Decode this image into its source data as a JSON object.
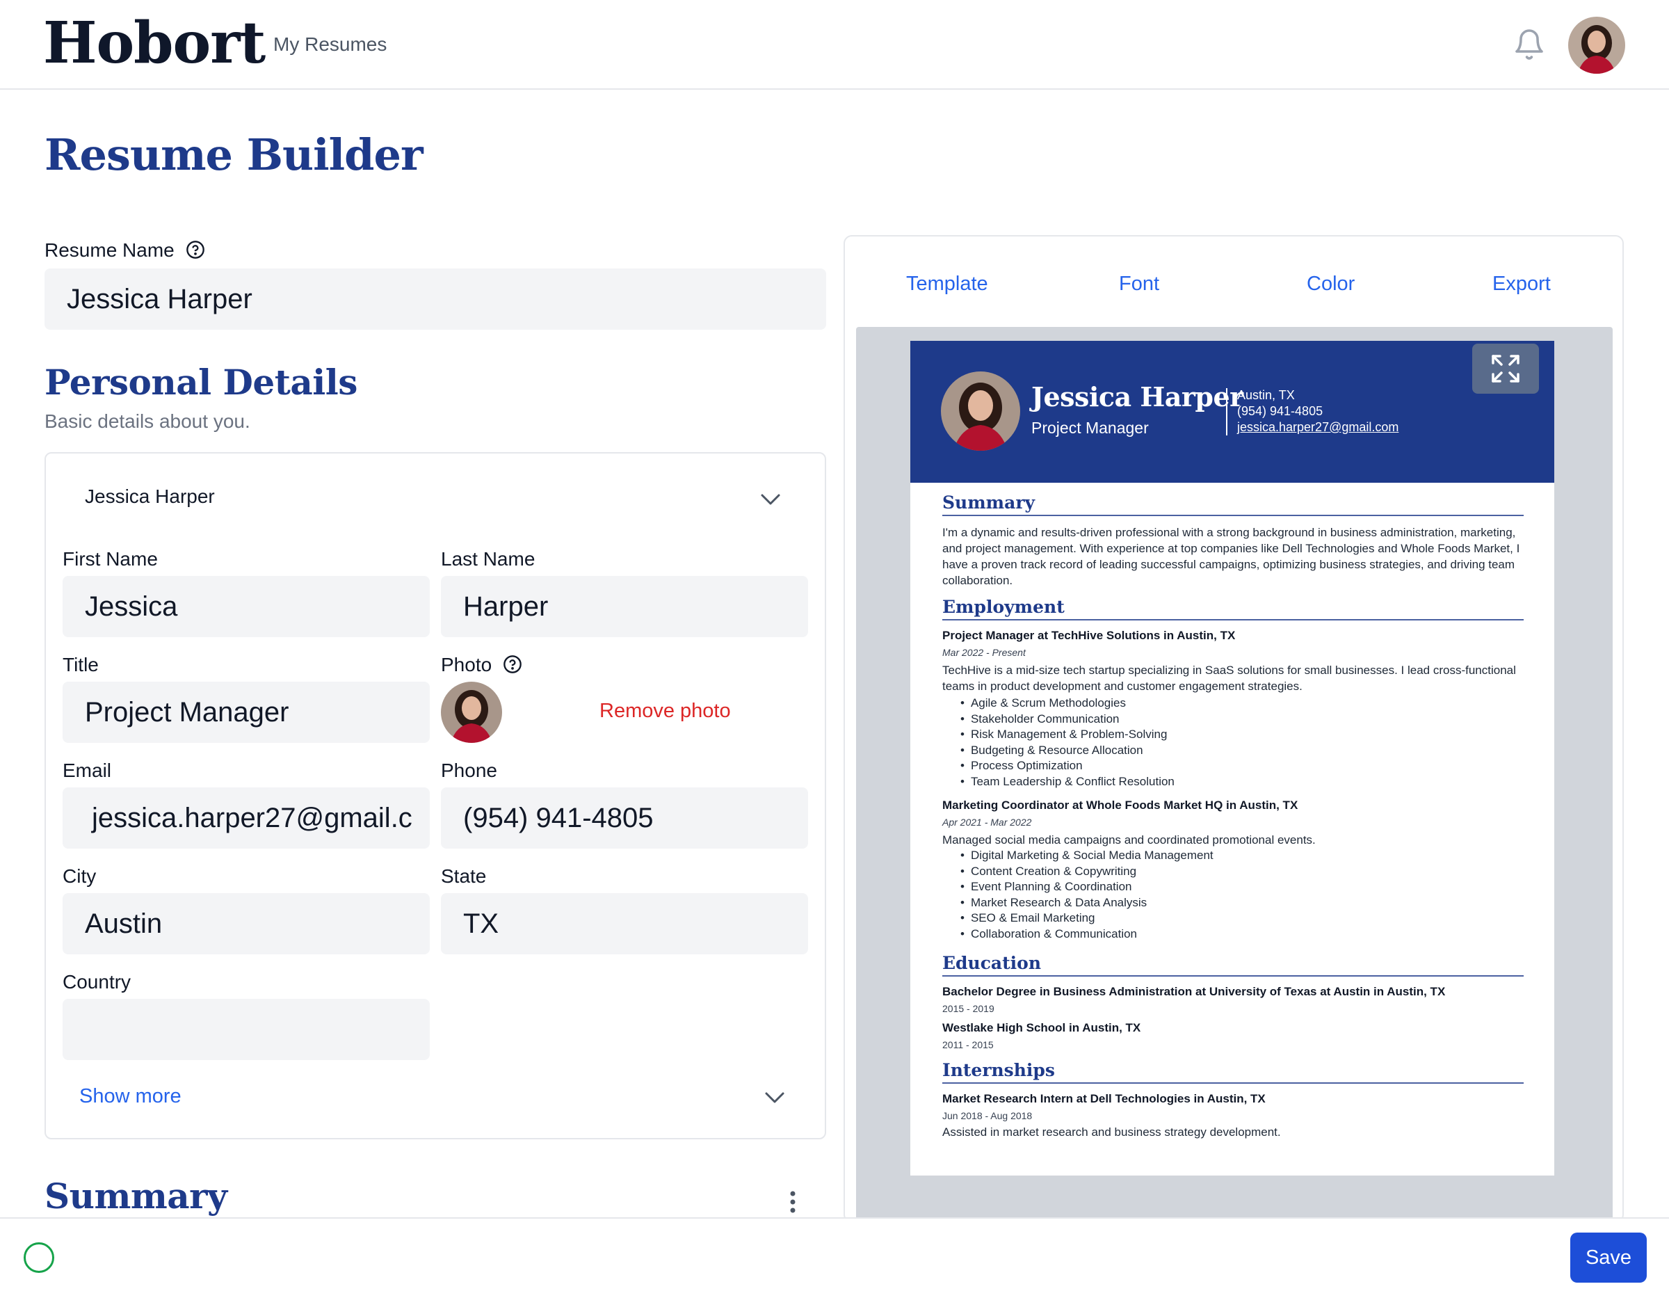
{
  "header": {
    "logo": "Hobort",
    "nav_my_resumes": "My Resumes"
  },
  "page_title": "Resume Builder",
  "resume_name": {
    "label": "Resume Name",
    "value": "Jessica Harper"
  },
  "personal_details": {
    "title": "Personal Details",
    "subtitle": "Basic details about you.",
    "card_header": "Jessica Harper",
    "first_name": {
      "label": "First Name",
      "value": "Jessica"
    },
    "last_name": {
      "label": "Last Name",
      "value": "Harper"
    },
    "title_field": {
      "label": "Title",
      "value": "Project Manager"
    },
    "photo": {
      "label": "Photo",
      "remove_label": "Remove photo"
    },
    "email": {
      "label": "Email",
      "value": "jessica.harper27@gmail.c"
    },
    "phone": {
      "label": "Phone",
      "value": "(954) 941-4805"
    },
    "city": {
      "label": "City",
      "value": "Austin"
    },
    "state": {
      "label": "State",
      "value": "TX"
    },
    "country": {
      "label": "Country",
      "value": ""
    },
    "show_more": "Show more"
  },
  "summary_section": {
    "title": "Summary"
  },
  "preview": {
    "tabs": [
      "Template",
      "Font",
      "Color",
      "Export"
    ],
    "name": "Jessica Harper",
    "job_title": "Project Manager",
    "contact": [
      "Austin, TX",
      "(954) 941-4805",
      "jessica.harper27@gmail.com"
    ],
    "summary_heading": "Summary",
    "summary_text": "I'm a dynamic and results-driven professional with a strong background in business administration, marketing, and project management. With experience at top companies like Dell Technologies and Whole Foods Market, I have a proven track record of leading successful campaigns, optimizing business strategies, and driving team collaboration.",
    "employment_heading": "Employment",
    "jobs": [
      {
        "title": "Project Manager at TechHive Solutions in Austin, TX",
        "dates": "Mar 2022 - Present",
        "description": "TechHive is a mid-size tech startup specializing in SaaS solutions for small businesses. I lead cross-functional teams in product development and customer engagement strategies.",
        "bullets": [
          "Agile & Scrum Methodologies",
          "Stakeholder Communication",
          "Risk Management & Problem-Solving",
          "Budgeting & Resource Allocation",
          "Process Optimization",
          "Team Leadership & Conflict Resolution"
        ]
      },
      {
        "title": "Marketing Coordinator at Whole Foods Market HQ in Austin, TX",
        "dates": "Apr 2021 - Mar 2022",
        "description": "Managed social media campaigns and coordinated promotional events.",
        "bullets": [
          "Digital Marketing & Social Media Management",
          "Content Creation & Copywriting",
          "Event Planning & Coordination",
          "Market Research & Data Analysis",
          "SEO & Email Marketing",
          "Collaboration & Communication"
        ]
      }
    ],
    "education_heading": "Education",
    "education": [
      {
        "title": "Bachelor Degree in Business Administration at University of Texas at Austin in Austin, TX",
        "dates": "2015 - 2019"
      },
      {
        "title": "Westlake High School in Austin, TX",
        "dates": "2011 - 2015"
      }
    ],
    "internships_heading": "Internships",
    "internships": [
      {
        "title": "Market Research Intern at Dell Technologies in Austin, TX",
        "dates": "Jun 2018 - Aug 2018",
        "description": "Assisted in market research and business strategy development."
      }
    ]
  },
  "footer": {
    "save_label": "Save"
  },
  "colors": {
    "brand_blue": "#1e3a8a",
    "link_blue": "#2563eb",
    "danger": "#dc2626",
    "status_green": "#16a34a"
  }
}
